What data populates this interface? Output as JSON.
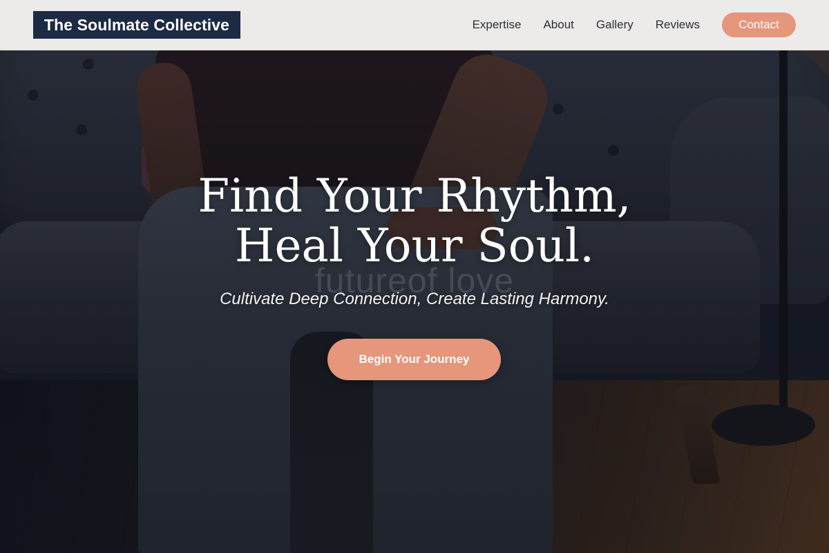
{
  "brand": {
    "name": "The Soulmate Collective"
  },
  "nav": {
    "links": [
      {
        "label": "Expertise"
      },
      {
        "label": "About"
      },
      {
        "label": "Gallery"
      },
      {
        "label": "Reviews"
      }
    ],
    "contact_label": "Contact"
  },
  "hero": {
    "headline_line1": "Find Your Rhythm,",
    "headline_line2": "Heal Your Soul.",
    "watermark": "futureof love",
    "tagline": "Cultivate Deep Connection, Create Lasting Harmony.",
    "cta_label": "Begin Your Journey"
  },
  "colors": {
    "accent": "#e6967b",
    "brand_dark": "#1d2a44",
    "header_bg": "#ecebea"
  }
}
